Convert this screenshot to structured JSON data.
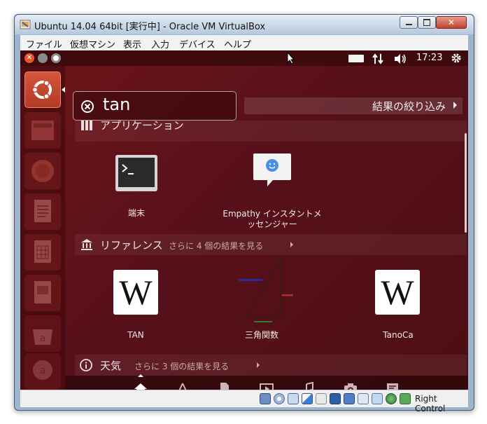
{
  "window": {
    "title": "Ubuntu 14.04 64bit [実行中] - Oracle VM VirtualBox"
  },
  "menubar": {
    "items": [
      "ファイル",
      "仮想マシン",
      "表示",
      "入力",
      "デバイス",
      "ヘルプ"
    ]
  },
  "panel": {
    "time": "17:23"
  },
  "search": {
    "query": "tan",
    "filter_label": "結果の絞り込み"
  },
  "sections": {
    "applications": {
      "title": "アプリケーション",
      "items": [
        {
          "label": "端末",
          "icon": "terminal-icon"
        },
        {
          "label_line1": "Empathy インスタントメ",
          "label_line2": "ッセンジャー",
          "icon": "empathy-icon"
        }
      ]
    },
    "reference": {
      "title": "リファレンス",
      "more": "さらに 4 個の結果を見る",
      "items": [
        {
          "label": "TAN",
          "icon": "wikipedia-icon"
        },
        {
          "label": "三角関数",
          "icon": "triangle-diagram-icon"
        },
        {
          "label": "TanoCa",
          "icon": "wikipedia-icon"
        }
      ]
    },
    "weather": {
      "title": "天気",
      "more": "さらに 3 個の結果を見る"
    }
  },
  "wiki_glyph": "W",
  "statusbar": {
    "host_key": "Right Control"
  },
  "colors": {
    "dash_bg": "#5a1013",
    "panel_bg": "#3e0a0c",
    "launcher_active": "#c9462f"
  }
}
